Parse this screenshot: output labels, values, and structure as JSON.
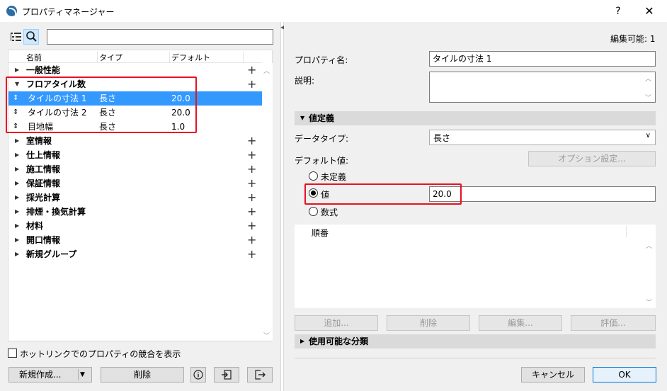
{
  "window": {
    "title": "プロパティマネージャー",
    "help": "?",
    "close": "✕"
  },
  "left": {
    "search_placeholder": "",
    "columns": [
      "名前",
      "タイプ",
      "デフォルト"
    ],
    "groups": [
      {
        "name": "一般性能"
      },
      {
        "name": "フロアタイル数"
      },
      {
        "name": "室情報"
      },
      {
        "name": "仕上情報"
      },
      {
        "name": "施工情報"
      },
      {
        "name": "保証情報"
      },
      {
        "name": "採光計算"
      },
      {
        "name": "排煙・換気計算"
      },
      {
        "name": "材料"
      },
      {
        "name": "開口情報"
      },
      {
        "name": "新規グループ"
      }
    ],
    "items": [
      {
        "name": "タイルの寸法 1",
        "type": "長さ",
        "default": "20.0"
      },
      {
        "name": "タイルの寸法 2",
        "type": "長さ",
        "default": "20.0"
      },
      {
        "name": "目地幅",
        "type": "長さ",
        "default": "1.0"
      }
    ],
    "hotlink_label": "ホットリンクでのプロパティの競合を表示",
    "hotlink_checked": false,
    "new_button": "新規作成...",
    "delete_button": "削除"
  },
  "right": {
    "editable": "編集可能: 1",
    "propname_label": "プロパティ名:",
    "propname_value": "タイルの寸法 1",
    "description_label": "説明:",
    "description_value": "",
    "value_def_title": "値定義",
    "datatype_label": "データタイプ:",
    "datatype_value": "長さ",
    "default_label": "デフォルト値:",
    "option_button": "オプション設定...",
    "radio_undefined": "未定義",
    "radio_value": "値",
    "radio_formula": "数式",
    "selected_radio": "値",
    "value": "20.0",
    "order_header": "順番",
    "add_button": "追加...",
    "delete_button": "削除",
    "edit_button": "編集...",
    "eval_button": "評価...",
    "available_title": "使用可能な分類",
    "cancel_button": "キャンセル",
    "ok_button": "OK"
  },
  "colors": {
    "selection": "#3399ff",
    "highlight_box": "#e81123",
    "panel": "#f0f0f0"
  }
}
